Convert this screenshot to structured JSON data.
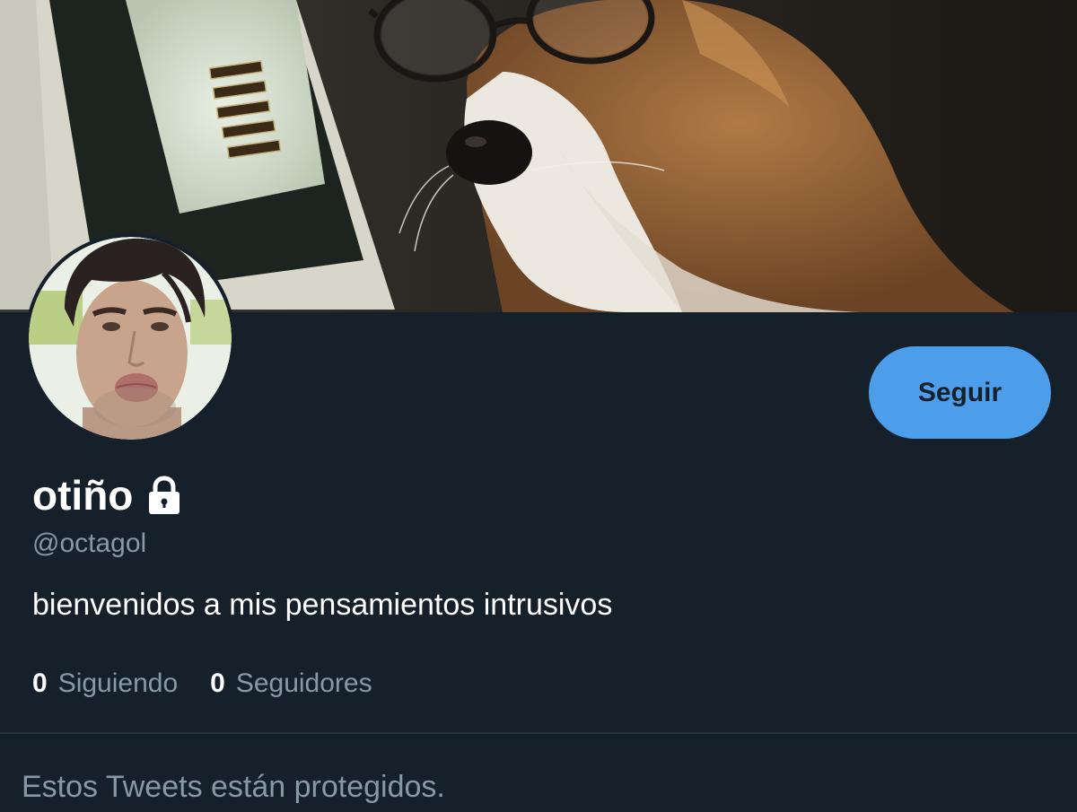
{
  "banner": {
    "image": "header-photo-dog-with-glasses"
  },
  "profile": {
    "avatar": "profile-photo",
    "display_name": "otiño",
    "protected_icon": "lock-icon",
    "handle": "@octagol",
    "bio": "bienvenidos a mis pensamientos intrusivos"
  },
  "actions": {
    "follow_label": "Seguir"
  },
  "stats": {
    "following_count": "0",
    "following_label": "Siguiendo",
    "followers_count": "0",
    "followers_label": "Seguidores"
  },
  "notice": {
    "protected_text": "Estos Tweets están protegidos."
  },
  "colors": {
    "background": "#15202b",
    "accent": "#4c9eeb",
    "secondary_text": "#8899a6",
    "divider": "#253341"
  }
}
